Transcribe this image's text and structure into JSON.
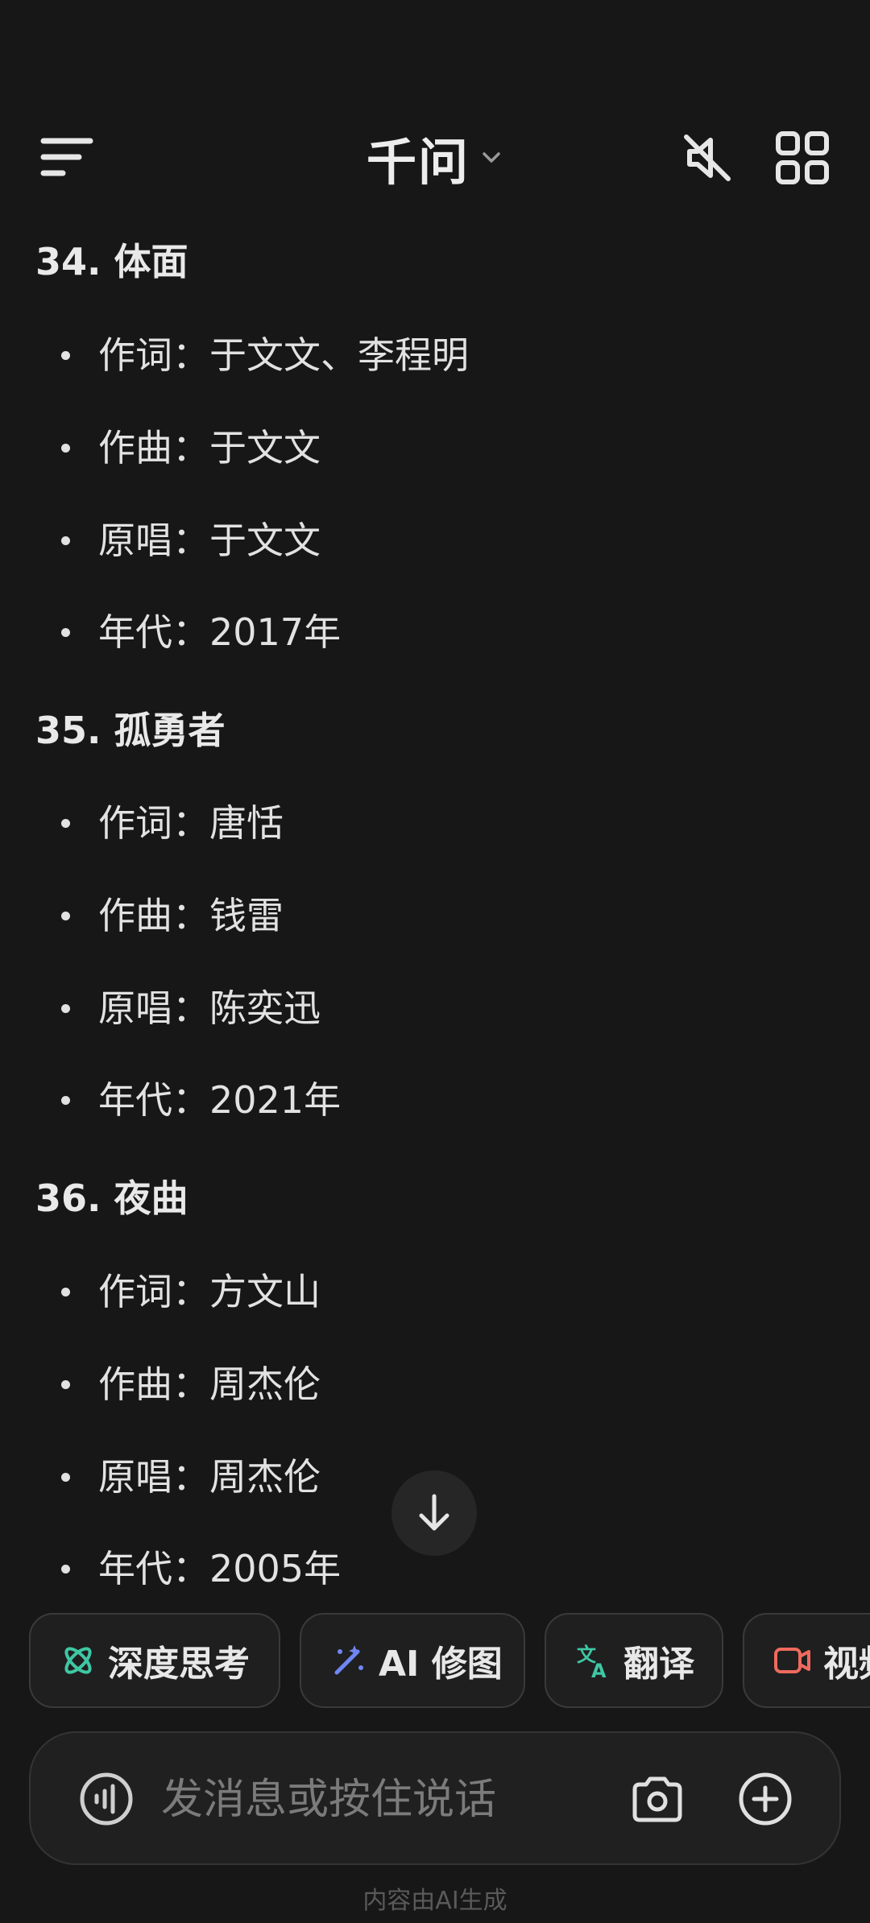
{
  "header": {
    "title": "千问",
    "icons": {
      "menu": "menu-icon",
      "dropdown": "chevron-down-icon",
      "mute": "speaker-muted-icon",
      "apps": "grid-icon"
    }
  },
  "songs": [
    {
      "title": "34. 体面",
      "lines": [
        "作词：于文文、李程明",
        "作曲：于文文",
        "原唱：于文文",
        "年代：2017年"
      ]
    },
    {
      "title": "35. 孤勇者",
      "lines": [
        "作词：唐恬",
        "作曲：钱雷",
        "原唱：陈奕迅",
        "年代：2021年"
      ]
    },
    {
      "title": "36. 夜曲",
      "lines": [
        "作词：方文山",
        "作曲：周杰伦",
        "原唱：周杰伦",
        "年代：2005年"
      ]
    }
  ],
  "chips": [
    {
      "label": "深度思考",
      "icon": "atom-icon",
      "color": "#3fc7a4"
    },
    {
      "label": "AI 修图",
      "icon": "magic-wand-icon",
      "color": "#6f86f5"
    },
    {
      "label": "翻译",
      "icon": "translate-icon",
      "color": "#3fc7a4"
    },
    {
      "label": "视频",
      "icon": "video-icon",
      "color": "#ef6a5e"
    }
  ],
  "input": {
    "placeholder": "发消息或按住说话"
  },
  "footer": {
    "note": "内容由AI生成"
  }
}
